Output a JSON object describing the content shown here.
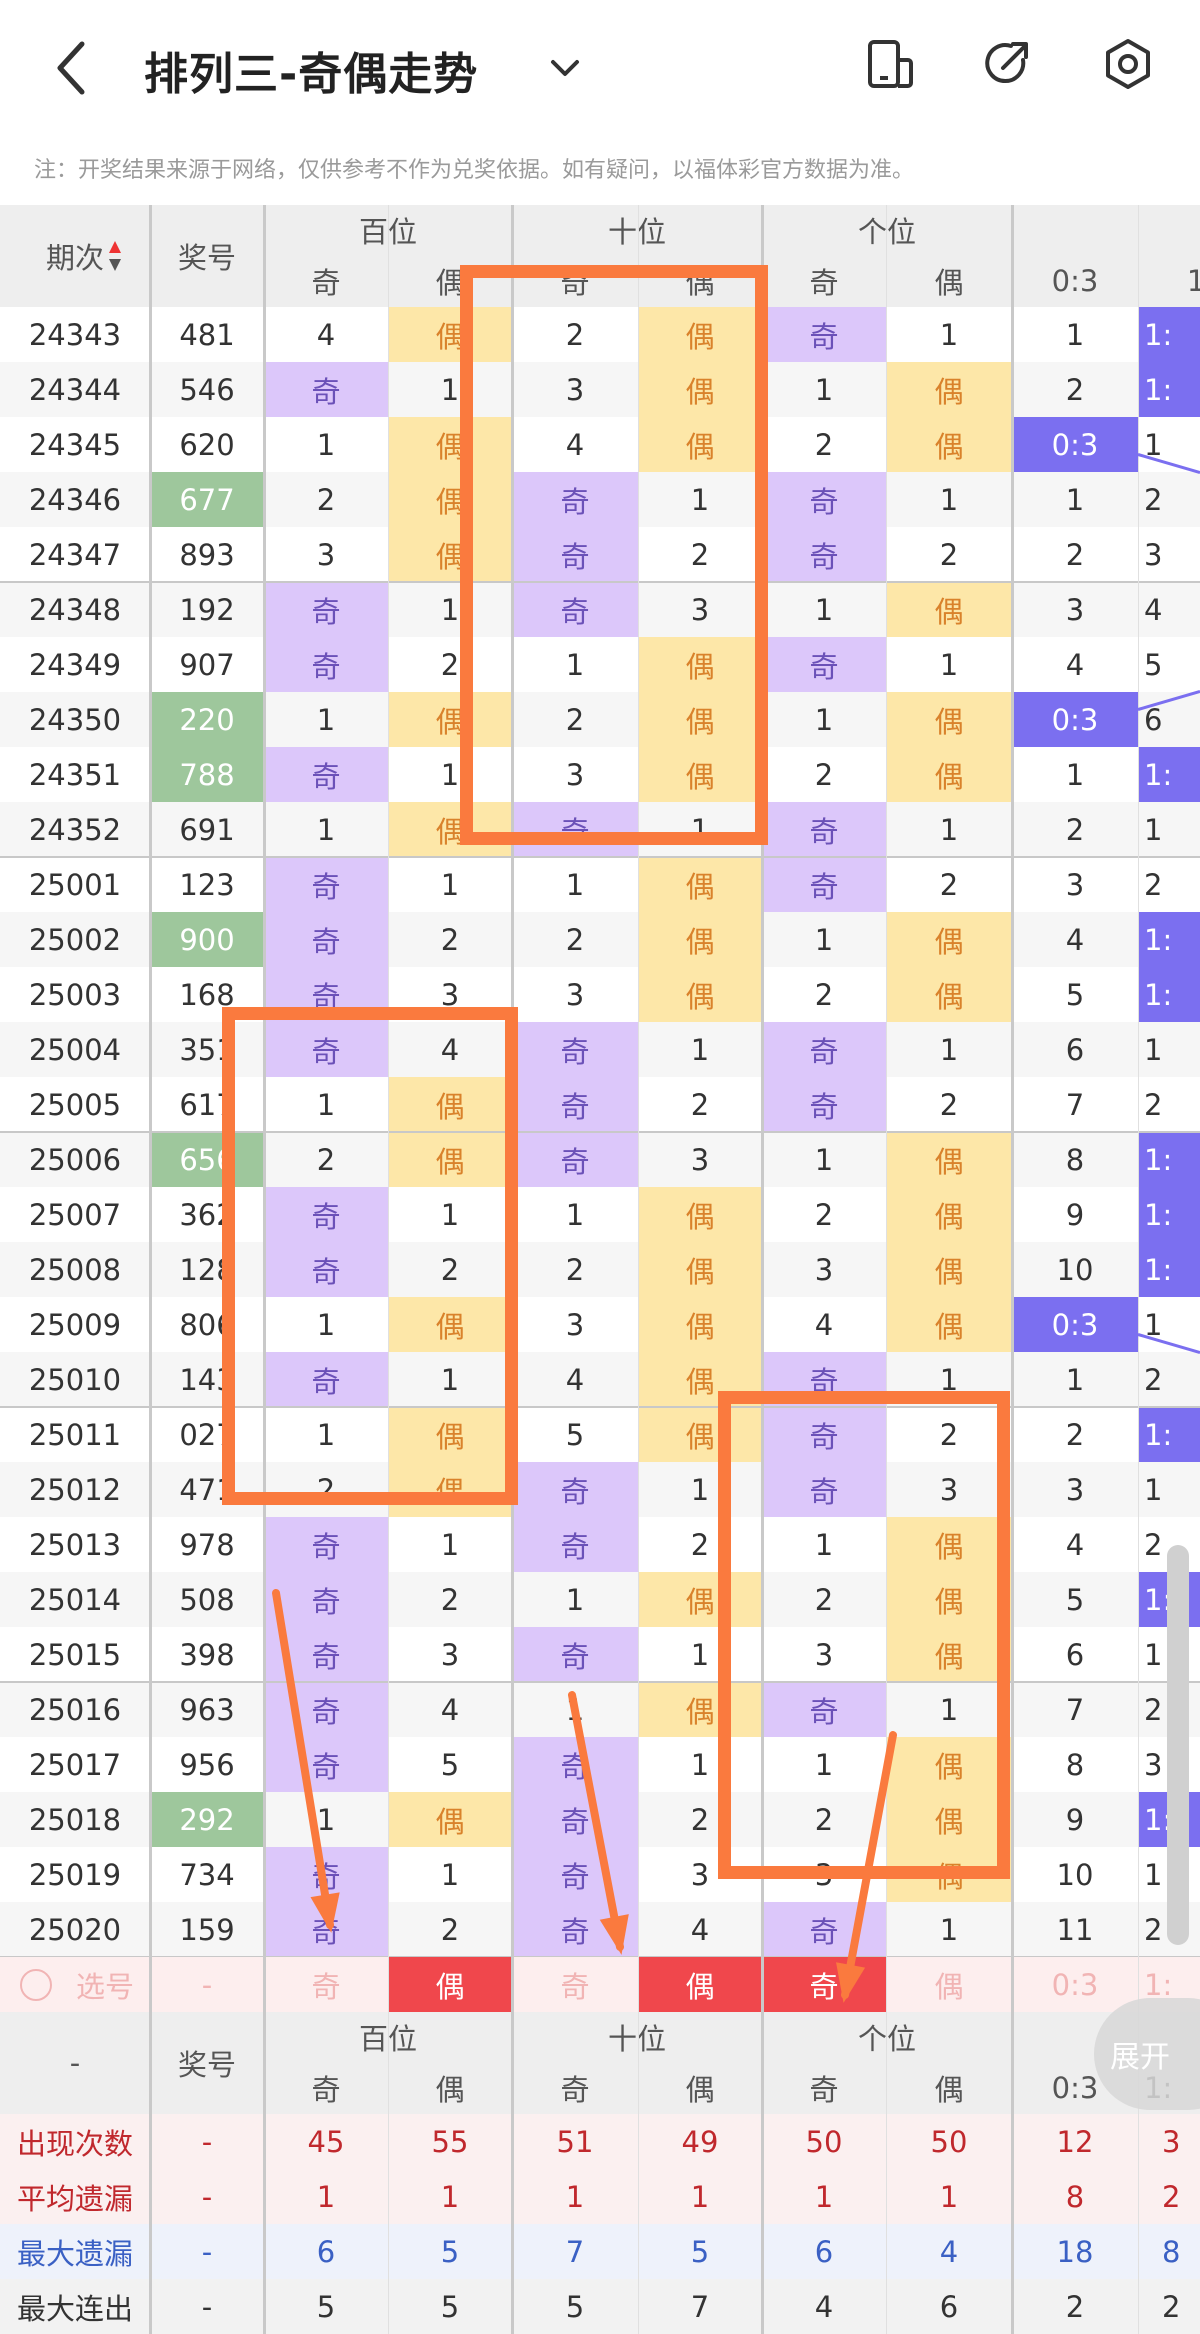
{
  "header": {
    "title": "排列三-奇偶走势",
    "note": "注：开奖结果来源于网络，仅供参考不作为兑奖依据。如有疑问，以福体彩官方数据为准。"
  },
  "columns": {
    "period": "期次",
    "number": "奖号",
    "groups": [
      "百位",
      "十位",
      "个位"
    ],
    "odd": "奇",
    "even": "偶",
    "ratio_03": "0:3",
    "ratio_12_partial": "1:"
  },
  "rows": [
    {
      "p": "24343",
      "n": "481",
      "green": false,
      "b": [
        "4",
        "偶"
      ],
      "s": [
        "2",
        "偶"
      ],
      "g": [
        "奇",
        "1"
      ],
      "r": "1",
      "r2": "1:"
    },
    {
      "p": "24344",
      "n": "546",
      "green": false,
      "b": [
        "奇",
        "1"
      ],
      "s": [
        "3",
        "偶"
      ],
      "g": [
        "1",
        "偶"
      ],
      "r": "2",
      "r2": "1:"
    },
    {
      "p": "24345",
      "n": "620",
      "green": false,
      "b": [
        "1",
        "偶"
      ],
      "s": [
        "4",
        "偶"
      ],
      "g": [
        "2",
        "偶"
      ],
      "r": "0:3",
      "r2": "1"
    },
    {
      "p": "24346",
      "n": "677",
      "green": true,
      "b": [
        "2",
        "偶"
      ],
      "s": [
        "奇",
        "1"
      ],
      "g": [
        "奇",
        "1"
      ],
      "r": "1",
      "r2": "2"
    },
    {
      "p": "24347",
      "n": "893",
      "green": false,
      "b": [
        "3",
        "偶"
      ],
      "s": [
        "奇",
        "2"
      ],
      "g": [
        "奇",
        "2"
      ],
      "r": "2",
      "r2": "3"
    },
    {
      "p": "24348",
      "n": "192",
      "green": false,
      "b": [
        "奇",
        "1"
      ],
      "s": [
        "奇",
        "3"
      ],
      "g": [
        "1",
        "偶"
      ],
      "r": "3",
      "r2": "4"
    },
    {
      "p": "24349",
      "n": "907",
      "green": false,
      "b": [
        "奇",
        "2"
      ],
      "s": [
        "1",
        "偶"
      ],
      "g": [
        "奇",
        "1"
      ],
      "r": "4",
      "r2": "5"
    },
    {
      "p": "24350",
      "n": "220",
      "green": true,
      "b": [
        "1",
        "偶"
      ],
      "s": [
        "2",
        "偶"
      ],
      "g": [
        "1",
        "偶"
      ],
      "r": "0:3",
      "r2": "6"
    },
    {
      "p": "24351",
      "n": "788",
      "green": true,
      "b": [
        "奇",
        "1"
      ],
      "s": [
        "3",
        "偶"
      ],
      "g": [
        "2",
        "偶"
      ],
      "r": "1",
      "r2": "1:"
    },
    {
      "p": "24352",
      "n": "691",
      "green": false,
      "b": [
        "1",
        "偶"
      ],
      "s": [
        "奇",
        "1"
      ],
      "g": [
        "奇",
        "1"
      ],
      "r": "2",
      "r2": "1"
    },
    {
      "p": "25001",
      "n": "123",
      "green": false,
      "b": [
        "奇",
        "1"
      ],
      "s": [
        "1",
        "偶"
      ],
      "g": [
        "奇",
        "2"
      ],
      "r": "3",
      "r2": "2"
    },
    {
      "p": "25002",
      "n": "900",
      "green": true,
      "b": [
        "奇",
        "2"
      ],
      "s": [
        "2",
        "偶"
      ],
      "g": [
        "1",
        "偶"
      ],
      "r": "4",
      "r2": "1:"
    },
    {
      "p": "25003",
      "n": "168",
      "green": false,
      "b": [
        "奇",
        "3"
      ],
      "s": [
        "3",
        "偶"
      ],
      "g": [
        "2",
        "偶"
      ],
      "r": "5",
      "r2": "1:"
    },
    {
      "p": "25004",
      "n": "351",
      "green": false,
      "b": [
        "奇",
        "4"
      ],
      "s": [
        "奇",
        "1"
      ],
      "g": [
        "奇",
        "1"
      ],
      "r": "6",
      "r2": "1"
    },
    {
      "p": "25005",
      "n": "617",
      "green": false,
      "b": [
        "1",
        "偶"
      ],
      "s": [
        "奇",
        "2"
      ],
      "g": [
        "奇",
        "2"
      ],
      "r": "7",
      "r2": "2"
    },
    {
      "p": "25006",
      "n": "656",
      "green": true,
      "b": [
        "2",
        "偶"
      ],
      "s": [
        "奇",
        "3"
      ],
      "g": [
        "1",
        "偶"
      ],
      "r": "8",
      "r2": "1:"
    },
    {
      "p": "25007",
      "n": "362",
      "green": false,
      "b": [
        "奇",
        "1"
      ],
      "s": [
        "1",
        "偶"
      ],
      "g": [
        "2",
        "偶"
      ],
      "r": "9",
      "r2": "1:"
    },
    {
      "p": "25008",
      "n": "128",
      "green": false,
      "b": [
        "奇",
        "2"
      ],
      "s": [
        "2",
        "偶"
      ],
      "g": [
        "3",
        "偶"
      ],
      "r": "10",
      "r2": "1:"
    },
    {
      "p": "25009",
      "n": "806",
      "green": false,
      "b": [
        "1",
        "偶"
      ],
      "s": [
        "3",
        "偶"
      ],
      "g": [
        "4",
        "偶"
      ],
      "r": "0:3",
      "r2": "1"
    },
    {
      "p": "25010",
      "n": "143",
      "green": false,
      "b": [
        "奇",
        "1"
      ],
      "s": [
        "4",
        "偶"
      ],
      "g": [
        "奇",
        "1"
      ],
      "r": "1",
      "r2": "2"
    },
    {
      "p": "25011",
      "n": "027",
      "green": false,
      "b": [
        "1",
        "偶"
      ],
      "s": [
        "5",
        "偶"
      ],
      "g": [
        "奇",
        "2"
      ],
      "r": "2",
      "r2": "1:"
    },
    {
      "p": "25012",
      "n": "471",
      "green": false,
      "b": [
        "2",
        "偶"
      ],
      "s": [
        "奇",
        "1"
      ],
      "g": [
        "奇",
        "3"
      ],
      "r": "3",
      "r2": "1"
    },
    {
      "p": "25013",
      "n": "978",
      "green": false,
      "b": [
        "奇",
        "1"
      ],
      "s": [
        "奇",
        "2"
      ],
      "g": [
        "1",
        "偶"
      ],
      "r": "4",
      "r2": "2"
    },
    {
      "p": "25014",
      "n": "508",
      "green": false,
      "b": [
        "奇",
        "2"
      ],
      "s": [
        "1",
        "偶"
      ],
      "g": [
        "2",
        "偶"
      ],
      "r": "5",
      "r2": "1:"
    },
    {
      "p": "25015",
      "n": "398",
      "green": false,
      "b": [
        "奇",
        "3"
      ],
      "s": [
        "奇",
        "1"
      ],
      "g": [
        "3",
        "偶"
      ],
      "r": "6",
      "r2": "1"
    },
    {
      "p": "25016",
      "n": "963",
      "green": false,
      "b": [
        "奇",
        "4"
      ],
      "s": [
        "1",
        "偶"
      ],
      "g": [
        "奇",
        "1"
      ],
      "r": "7",
      "r2": "2"
    },
    {
      "p": "25017",
      "n": "956",
      "green": false,
      "b": [
        "奇",
        "5"
      ],
      "s": [
        "奇",
        "1"
      ],
      "g": [
        "1",
        "偶"
      ],
      "r": "8",
      "r2": "3"
    },
    {
      "p": "25018",
      "n": "292",
      "green": true,
      "b": [
        "1",
        "偶"
      ],
      "s": [
        "奇",
        "2"
      ],
      "g": [
        "2",
        "偶"
      ],
      "r": "9",
      "r2": "1:"
    },
    {
      "p": "25019",
      "n": "734",
      "green": false,
      "b": [
        "奇",
        "1"
      ],
      "s": [
        "奇",
        "3"
      ],
      "g": [
        "3",
        "偶"
      ],
      "r": "10",
      "r2": "1"
    },
    {
      "p": "25020",
      "n": "159",
      "green": false,
      "b": [
        "奇",
        "2"
      ],
      "s": [
        "奇",
        "4"
      ],
      "g": [
        "奇",
        "1"
      ],
      "r": "11",
      "r2": "2"
    }
  ],
  "select_row": {
    "label": "选号",
    "dash": "-",
    "cells": [
      "奇",
      "偶",
      "奇",
      "偶",
      "奇",
      "偶"
    ],
    "ratio": "0:3",
    "ratio2": "1:"
  },
  "footer_header": {
    "dash": "-",
    "number": "奖号",
    "ratio": "0:3",
    "ratio2": "1:"
  },
  "stats": [
    {
      "label": "出现次数",
      "dash": "-",
      "vals": [
        "45",
        "55",
        "51",
        "49",
        "50",
        "50",
        "12",
        "3"
      ]
    },
    {
      "label": "平均遗漏",
      "dash": "-",
      "vals": [
        "1",
        "1",
        "1",
        "1",
        "1",
        "1",
        "8",
        "2"
      ]
    },
    {
      "label": "最大遗漏",
      "dash": "-",
      "vals": [
        "6",
        "5",
        "7",
        "5",
        "6",
        "4",
        "18",
        "8"
      ]
    },
    {
      "label": "最大连出",
      "dash": "-",
      "vals": [
        "5",
        "5",
        "5",
        "7",
        "4",
        "6",
        "2",
        "2"
      ]
    }
  ],
  "expand_label": "展开"
}
